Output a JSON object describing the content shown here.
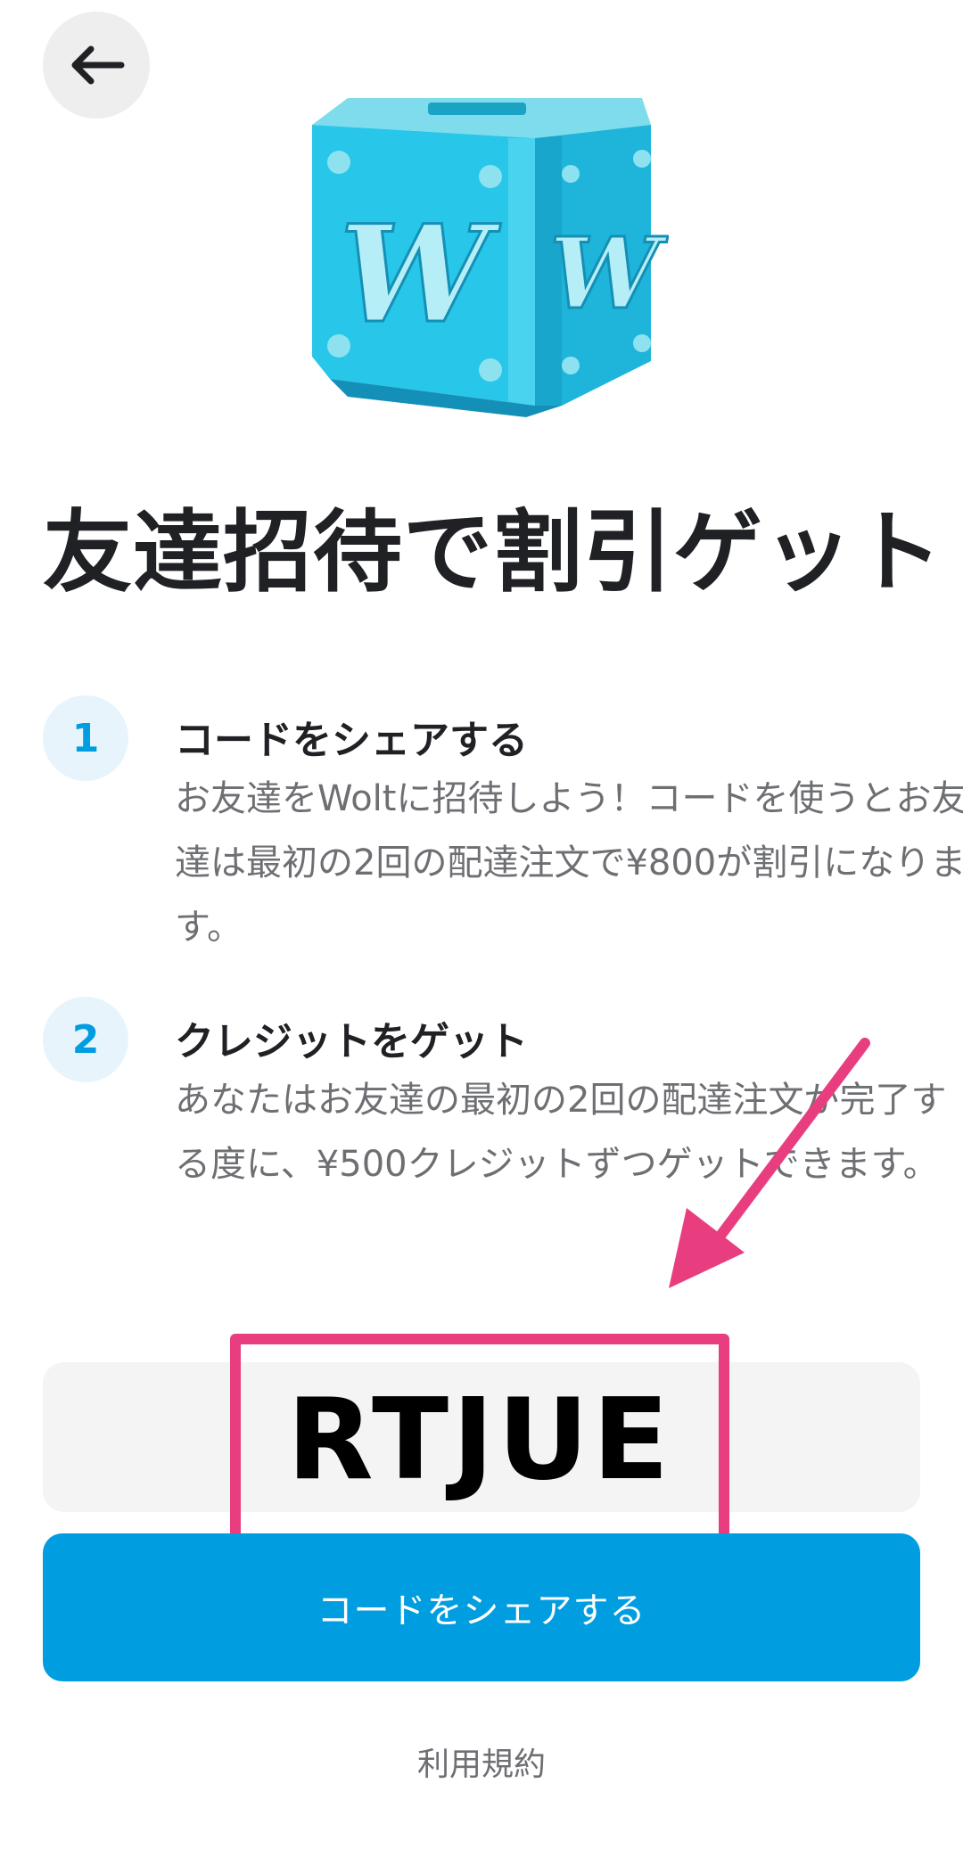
{
  "header": {
    "back_icon": "arrow-left-icon"
  },
  "hero": {
    "icon": "wolt-gift-box-icon",
    "letter": "W"
  },
  "title": "友達招待で割引ゲット",
  "steps": [
    {
      "number": "1",
      "title": "コードをシェアする",
      "description": "お友達をWoltに招待しよう！コードを使うとお友達は最初の2回の配達注文で¥800が割引になります。"
    },
    {
      "number": "2",
      "title": "クレジットをゲット",
      "description": "あなたはお友達の最初の2回の配達注文が完了する度に、¥500クレジットずつゲットできます。"
    }
  ],
  "referral": {
    "code": "RTJUE"
  },
  "share_button": {
    "label": "コードをシェアする"
  },
  "footer": {
    "terms_label": "利用規約"
  },
  "colors": {
    "accent": "#009de0",
    "badge_bg": "#e8f4fc",
    "annotation": "#e83e7f",
    "code_bg": "#f4f4f5"
  }
}
